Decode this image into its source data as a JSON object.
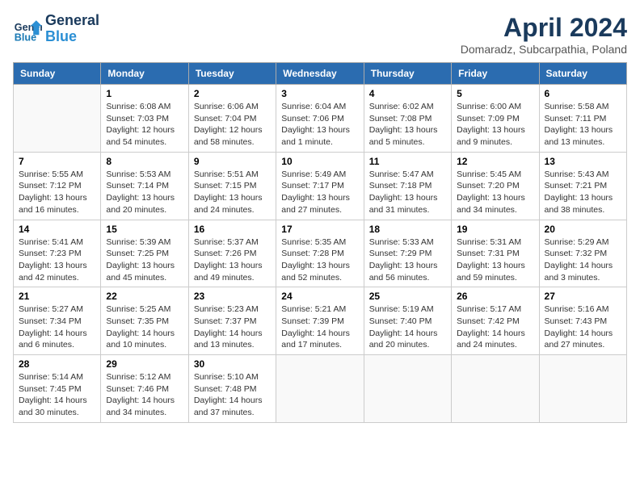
{
  "header": {
    "logo_line1": "General",
    "logo_line2": "Blue",
    "month": "April 2024",
    "location": "Domaradz, Subcarpathia, Poland"
  },
  "weekdays": [
    "Sunday",
    "Monday",
    "Tuesday",
    "Wednesday",
    "Thursday",
    "Friday",
    "Saturday"
  ],
  "weeks": [
    [
      null,
      {
        "day": 1,
        "sunrise": "6:08 AM",
        "sunset": "7:03 PM",
        "daylight": "12 hours and 54 minutes."
      },
      {
        "day": 2,
        "sunrise": "6:06 AM",
        "sunset": "7:04 PM",
        "daylight": "12 hours and 58 minutes."
      },
      {
        "day": 3,
        "sunrise": "6:04 AM",
        "sunset": "7:06 PM",
        "daylight": "13 hours and 1 minute."
      },
      {
        "day": 4,
        "sunrise": "6:02 AM",
        "sunset": "7:08 PM",
        "daylight": "13 hours and 5 minutes."
      },
      {
        "day": 5,
        "sunrise": "6:00 AM",
        "sunset": "7:09 PM",
        "daylight": "13 hours and 9 minutes."
      },
      {
        "day": 6,
        "sunrise": "5:58 AM",
        "sunset": "7:11 PM",
        "daylight": "13 hours and 13 minutes."
      }
    ],
    [
      {
        "day": 7,
        "sunrise": "5:55 AM",
        "sunset": "7:12 PM",
        "daylight": "13 hours and 16 minutes."
      },
      {
        "day": 8,
        "sunrise": "5:53 AM",
        "sunset": "7:14 PM",
        "daylight": "13 hours and 20 minutes."
      },
      {
        "day": 9,
        "sunrise": "5:51 AM",
        "sunset": "7:15 PM",
        "daylight": "13 hours and 24 minutes."
      },
      {
        "day": 10,
        "sunrise": "5:49 AM",
        "sunset": "7:17 PM",
        "daylight": "13 hours and 27 minutes."
      },
      {
        "day": 11,
        "sunrise": "5:47 AM",
        "sunset": "7:18 PM",
        "daylight": "13 hours and 31 minutes."
      },
      {
        "day": 12,
        "sunrise": "5:45 AM",
        "sunset": "7:20 PM",
        "daylight": "13 hours and 34 minutes."
      },
      {
        "day": 13,
        "sunrise": "5:43 AM",
        "sunset": "7:21 PM",
        "daylight": "13 hours and 38 minutes."
      }
    ],
    [
      {
        "day": 14,
        "sunrise": "5:41 AM",
        "sunset": "7:23 PM",
        "daylight": "13 hours and 42 minutes."
      },
      {
        "day": 15,
        "sunrise": "5:39 AM",
        "sunset": "7:25 PM",
        "daylight": "13 hours and 45 minutes."
      },
      {
        "day": 16,
        "sunrise": "5:37 AM",
        "sunset": "7:26 PM",
        "daylight": "13 hours and 49 minutes."
      },
      {
        "day": 17,
        "sunrise": "5:35 AM",
        "sunset": "7:28 PM",
        "daylight": "13 hours and 52 minutes."
      },
      {
        "day": 18,
        "sunrise": "5:33 AM",
        "sunset": "7:29 PM",
        "daylight": "13 hours and 56 minutes."
      },
      {
        "day": 19,
        "sunrise": "5:31 AM",
        "sunset": "7:31 PM",
        "daylight": "13 hours and 59 minutes."
      },
      {
        "day": 20,
        "sunrise": "5:29 AM",
        "sunset": "7:32 PM",
        "daylight": "14 hours and 3 minutes."
      }
    ],
    [
      {
        "day": 21,
        "sunrise": "5:27 AM",
        "sunset": "7:34 PM",
        "daylight": "14 hours and 6 minutes."
      },
      {
        "day": 22,
        "sunrise": "5:25 AM",
        "sunset": "7:35 PM",
        "daylight": "14 hours and 10 minutes."
      },
      {
        "day": 23,
        "sunrise": "5:23 AM",
        "sunset": "7:37 PM",
        "daylight": "14 hours and 13 minutes."
      },
      {
        "day": 24,
        "sunrise": "5:21 AM",
        "sunset": "7:39 PM",
        "daylight": "14 hours and 17 minutes."
      },
      {
        "day": 25,
        "sunrise": "5:19 AM",
        "sunset": "7:40 PM",
        "daylight": "14 hours and 20 minutes."
      },
      {
        "day": 26,
        "sunrise": "5:17 AM",
        "sunset": "7:42 PM",
        "daylight": "14 hours and 24 minutes."
      },
      {
        "day": 27,
        "sunrise": "5:16 AM",
        "sunset": "7:43 PM",
        "daylight": "14 hours and 27 minutes."
      }
    ],
    [
      {
        "day": 28,
        "sunrise": "5:14 AM",
        "sunset": "7:45 PM",
        "daylight": "14 hours and 30 minutes."
      },
      {
        "day": 29,
        "sunrise": "5:12 AM",
        "sunset": "7:46 PM",
        "daylight": "14 hours and 34 minutes."
      },
      {
        "day": 30,
        "sunrise": "5:10 AM",
        "sunset": "7:48 PM",
        "daylight": "14 hours and 37 minutes."
      },
      null,
      null,
      null,
      null
    ]
  ]
}
